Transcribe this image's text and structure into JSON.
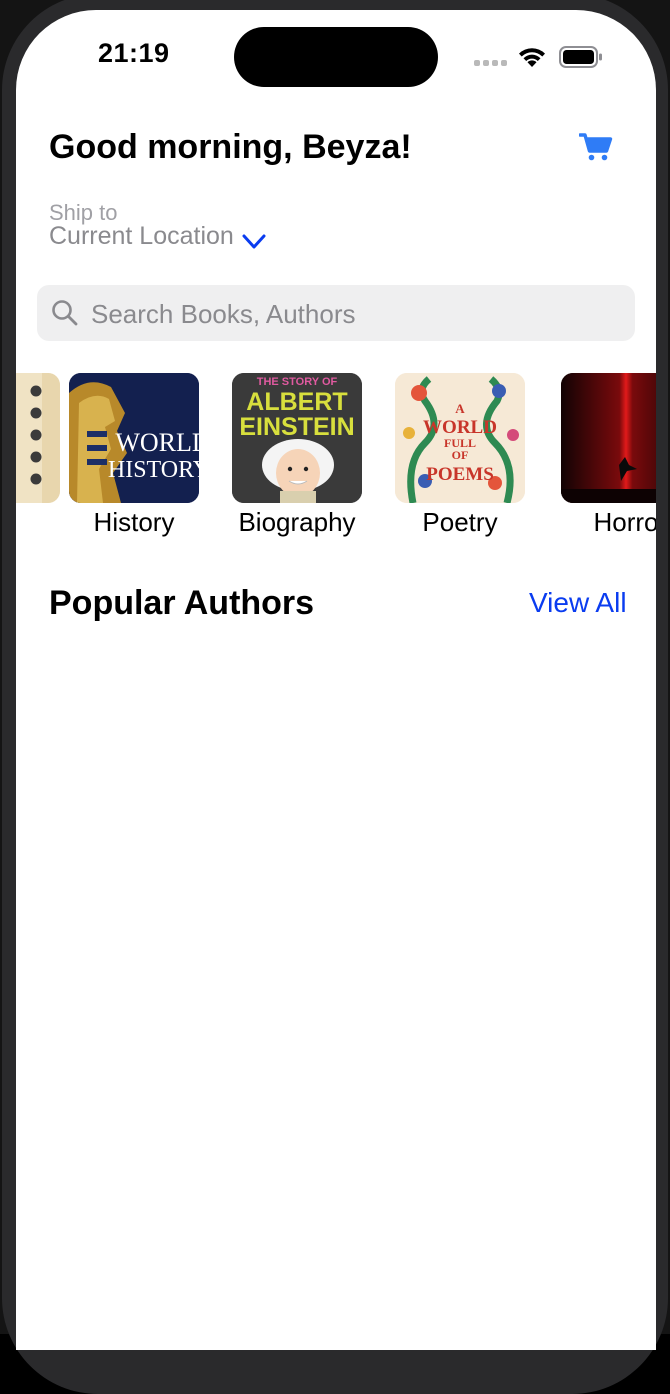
{
  "status_bar": {
    "time": "21:19",
    "icons": [
      "cellular-signal-icon",
      "wifi-icon",
      "battery-icon"
    ]
  },
  "header": {
    "greeting": "Good morning, Beyza!",
    "cart_icon": "cart-icon"
  },
  "shipping": {
    "label": "Ship to",
    "location": "Current Location",
    "chevron_icon": "chevron-down-icon"
  },
  "search": {
    "placeholder": "Search Books, Authors",
    "value": "",
    "icon": "search-icon"
  },
  "categories": [
    {
      "label": "",
      "cover": "partial-book-cover"
    },
    {
      "label": "History",
      "cover": "world-history-cover"
    },
    {
      "label": "Biography",
      "cover": "albert-einstein-cover"
    },
    {
      "label": "Poetry",
      "cover": "world-full-of-poems-cover"
    },
    {
      "label": "Horro",
      "cover": "horror-cover"
    }
  ],
  "covers": {
    "history_title_1": "WORLD",
    "history_title_2": "HISTORY",
    "biography_top": "THE STORY OF",
    "biography_name_1": "ALBERT",
    "biography_name_2": "EINSTEIN",
    "poetry_1": "A",
    "poetry_2": "WORLD",
    "poetry_3": "FULL",
    "poetry_4": "OF",
    "poetry_5": "POEMS"
  },
  "popular_authors": {
    "title": "Popular Authors",
    "view_all": "View All"
  },
  "colors": {
    "accent_blue": "#0a3cf0",
    "cart_blue": "#2f7cf6",
    "search_bg": "#efeff0",
    "secondary_text": "#8a8a8e"
  }
}
